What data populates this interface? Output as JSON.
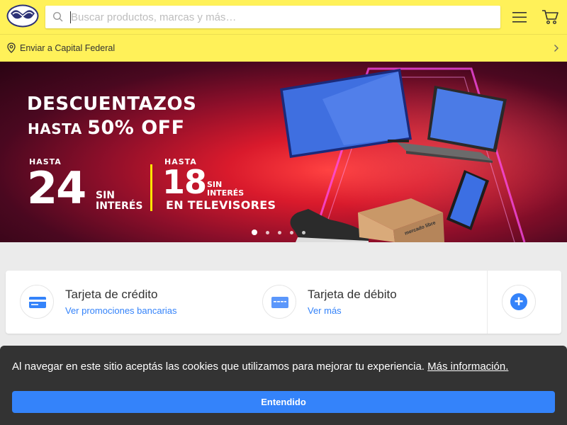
{
  "header": {
    "search": {
      "placeholder": "Buscar productos, marcas y más…",
      "value": ""
    },
    "location_text": "Enviar a Capital Federal",
    "colors": {
      "header_bg": "#fff159",
      "accent": "#3483fa"
    }
  },
  "banner": {
    "title_line1": "DESCUENTAZOS",
    "title_line2_prefix": "HASTA",
    "title_line2_highlight": "50% OFF",
    "offer1": {
      "label": "HASTA",
      "number": "24",
      "line1": "SIN",
      "line2": "INTERÉS"
    },
    "offer2": {
      "label": "HASTA",
      "number": "18",
      "line1": "SIN",
      "line2": "INTERÉS",
      "category": "EN TELEVISORES"
    },
    "slides_count": 5,
    "active_slide": 1,
    "box_brand": "mercado libre"
  },
  "payments": {
    "items": [
      {
        "title": "Tarjeta de crédito",
        "link": "Ver promociones bancarias",
        "icon": "credit-card-icon"
      },
      {
        "title": "Tarjeta de débito",
        "link": "Ver más",
        "icon": "debit-card-icon"
      }
    ],
    "more_icon": "plus-icon"
  },
  "cookie": {
    "message": "Al navegar en este sitio aceptás las cookies que utilizamos para mejorar tu experiencia.",
    "link": "Más información.",
    "button": "Entendido"
  }
}
